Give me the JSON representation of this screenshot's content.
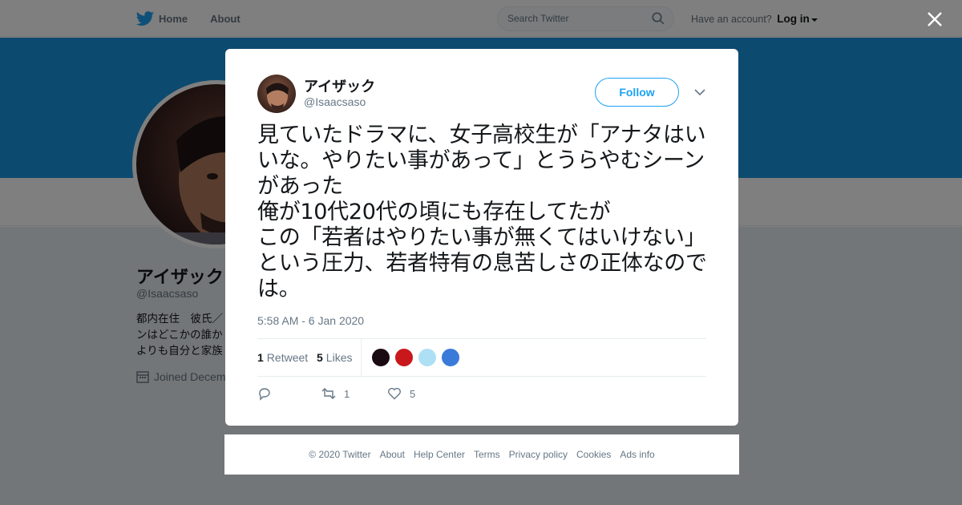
{
  "nav": {
    "home": "Home",
    "about": "About",
    "search_placeholder": "Search Twitter",
    "have_account": "Have an account?",
    "login": "Log in"
  },
  "profile": {
    "name": "アイザック",
    "handle": "@Isaacsaso",
    "bio": "都内在住　彼氏／\nンはどこかの誰か\nよりも自分と家族",
    "joined": "Joined Decem"
  },
  "tweet": {
    "author_name": "アイザック",
    "author_handle": "@Isaacsaso",
    "follow_label": "Follow",
    "text": "見ていたドラマに、女子高校生が「アナタはいいな。やりたい事があって」とうらやむシーンがあった\n俺が10代20代の頃にも存在してたが\nこの「若者はやりたい事が無くてはいけない」という圧力、若者特有の息苦しさの正体なのでは。",
    "timestamp": "5:58 AM - 6 Jan 2020",
    "retweet_count": "1",
    "retweet_label": "Retweet",
    "like_count": "5",
    "like_label": "Likes",
    "action_retweet_count": "1",
    "action_like_count": "5",
    "likers": [
      {
        "color": "#1a0a12"
      },
      {
        "color": "#c8181c"
      },
      {
        "color": "#aee0f5"
      },
      {
        "color": "#3a7ad8"
      }
    ]
  },
  "footer": {
    "links": [
      "© 2020 Twitter",
      "About",
      "Help Center",
      "Terms",
      "Privacy policy",
      "Cookies",
      "Ads info"
    ]
  },
  "colors": {
    "accent": "#1da1f2",
    "banner": "#1b95e0"
  }
}
